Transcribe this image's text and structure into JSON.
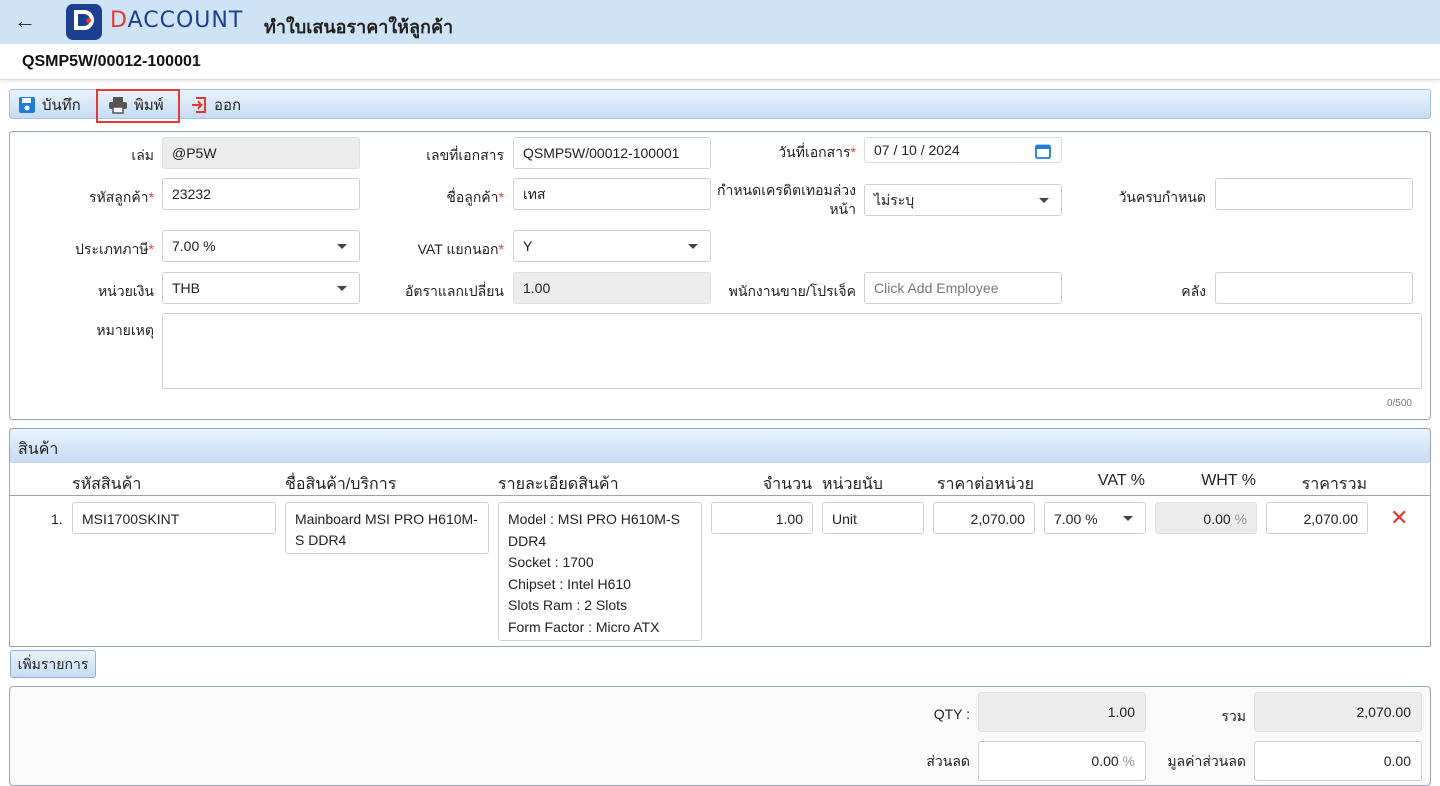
{
  "header": {
    "back_icon": "arrow-left-icon",
    "logo_text_a": "D",
    "logo_text_b": "ACCOUNT",
    "title": "ทำใบเสนอราคาให้ลูกค้า",
    "document_number": "QSMP5W/00012-100001"
  },
  "toolbar": {
    "save_label": "บันทึก",
    "print_label": "พิมพ์",
    "exit_label": "ออก"
  },
  "form": {
    "book_label": "เล่ม",
    "book_value": "@P5W",
    "doc_no_label": "เลขที่เอกสาร",
    "doc_no_value": "QSMP5W/00012-100001",
    "doc_date_label": "วันที่เอกสาร",
    "doc_date_value": "07 / 10 /  2024",
    "customer_code_label": "รหัสลูกค้า",
    "customer_code_value": "23232",
    "customer_name_label": "ชื่อลูกค้า",
    "customer_name_value": "เทส",
    "credit_label_1": "กำหนดเครดิตเทอมล่วง",
    "credit_label_2": "หน้า",
    "credit_value": "ไม่ระบุ",
    "due_date_label": "วันครบกำหนด",
    "due_date_value": "",
    "tax_type_label": "ประเภทภาษี",
    "tax_type_value": "7.00 %",
    "vat_sep_label": "VAT แยกนอก",
    "vat_sep_value": "Y",
    "currency_label": "หน่วยเงิน",
    "currency_value": "THB",
    "rate_label": "อัตราแลกเปลี่ยน",
    "rate_value": "1.00",
    "employee_label": "พนักงานขาย/โปรเจ็ค",
    "employee_placeholder": "Click Add Employee",
    "warehouse_label": "คลัง",
    "warehouse_value": "",
    "note_label": "หมายเหตุ",
    "note_value": "",
    "note_counter": "0/500",
    "required_mark": "*"
  },
  "products": {
    "section_title": "สินค้า",
    "columns": {
      "code": "รหัสสินค้า",
      "name": "ชื่อสินค้า/บริการ",
      "detail": "รายละเอียดสินค้า",
      "qty": "จำนวน",
      "unit": "หน่วยนับ",
      "price": "ราคาต่อหน่วย",
      "vat": "VAT %",
      "wht": "WHT %",
      "total": "ราคารวม"
    },
    "rows": [
      {
        "index": "1.",
        "code": "MSI1700SKINT",
        "name": "Mainboard MSI PRO H610M-S DDR4",
        "detail": [
          "Model : MSI PRO H610M-S",
          "DDR4",
          "Socket : 1700",
          "Chipset : Intel H610",
          "Slots Ram : 2 Slots",
          "Form Factor : Micro ATX"
        ],
        "qty": "1.00",
        "unit": "Unit",
        "price": "2,070.00",
        "vat": "7.00 %",
        "wht": "0.00",
        "wht_suffix": "%",
        "total": "2,070.00",
        "delete_icon": "close-x-icon"
      }
    ],
    "add_row_label": "เพิ่มรายการ"
  },
  "totals": {
    "qty_label": "QTY :",
    "qty_value": "1.00",
    "sum_label": "รวม",
    "sum_value": "2,070.00",
    "discount_label": "ส่วนลด",
    "discount_value": "0.00",
    "discount_suffix": "%",
    "discount_amount_label": "มูลค่าส่วนลด",
    "discount_amount_value": "0.00"
  },
  "colors": {
    "header_bg": "#cfe3f7",
    "brand_blue": "#1d3f8f",
    "accent_red": "#e53935",
    "calendar_blue": "#1e7bd6"
  }
}
